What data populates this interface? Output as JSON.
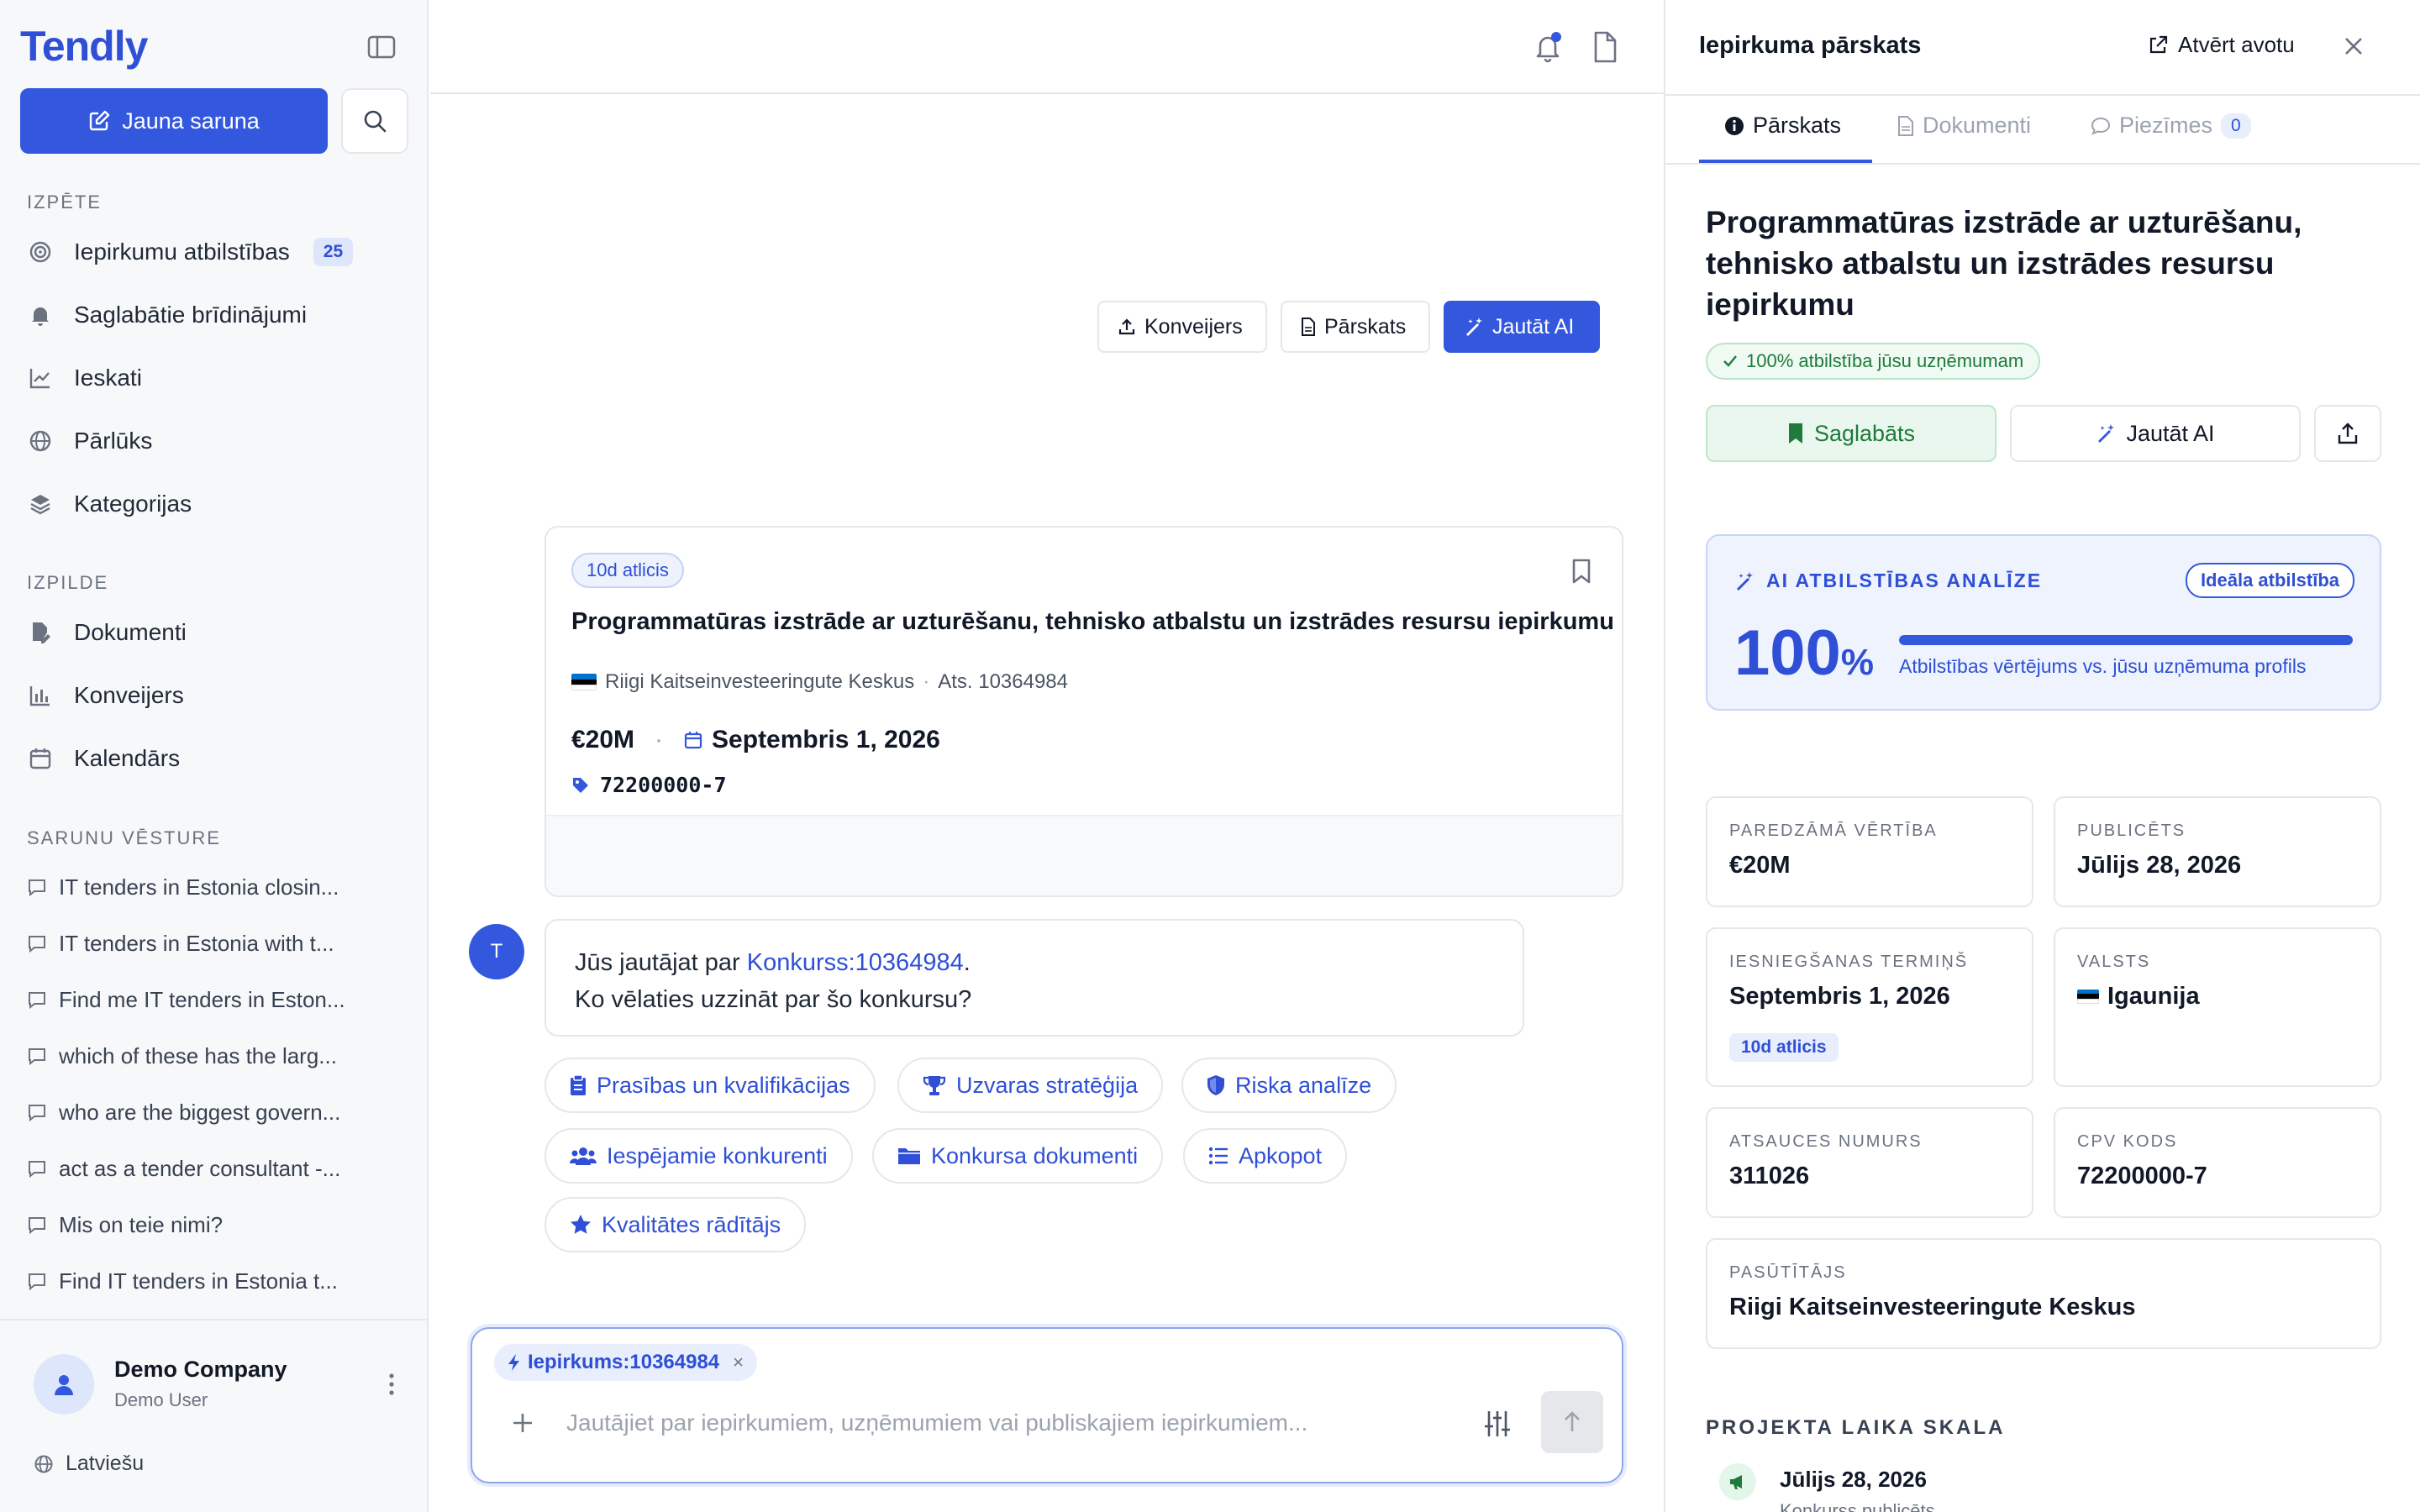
{
  "app": {
    "logo": "Tendly",
    "new_chat_label": "Jauna saruna"
  },
  "sidebar": {
    "research_label": "IZPĒTE",
    "research_items": [
      {
        "label": "Iepirkumu atbilstības",
        "badge": "25",
        "icon": "target-icon"
      },
      {
        "label": "Saglabātie brīdinājumi",
        "icon": "bell-icon"
      },
      {
        "label": "Ieskati",
        "icon": "chart-line-icon"
      },
      {
        "label": "Pārlūks",
        "icon": "globe-icon"
      },
      {
        "label": "Kategorijas",
        "icon": "layers-icon"
      }
    ],
    "execution_label": "IZPILDE",
    "execution_items": [
      {
        "label": "Dokumenti",
        "icon": "file-edit-icon"
      },
      {
        "label": "Konveijers",
        "icon": "bar-chart-icon"
      },
      {
        "label": "Kalendārs",
        "icon": "calendar-icon"
      }
    ],
    "history_label": "SARUNU VĒSTURE",
    "history": [
      "IT tenders in Estonia closin...",
      "IT tenders in Estonia with t...",
      "Find me IT tenders in Eston...",
      "which of these has the larg...",
      "who are the biggest govern...",
      "act as a tender consultant -...",
      "Mis on teie nimi?",
      "Find IT tenders in Estonia t..."
    ],
    "user": {
      "name": "Demo Company",
      "sub": "Demo User",
      "initial_icon": "user-icon"
    },
    "language": "Latviešu"
  },
  "tender_card": {
    "days_left": "10d atlicis",
    "title": "Programmatūras izstrāde ar uzturēšanu, tehnisko atbalstu un izstrādes resursu iepirkumu",
    "buyer": "Riigi Kaitseinvesteeringute Keskus",
    "separator": "·",
    "ref": "Ats. 10364984",
    "value": "€20M",
    "deadline": "Septembris 1, 2026",
    "cpv": "72200000-7",
    "actions": {
      "pipeline": "Konveijers",
      "overview": "Pārskats",
      "ask_ai": "Jautāt AI"
    }
  },
  "message": {
    "avatar": "T",
    "text_before": "Jūs jautājat par ",
    "link": "Konkurss:10364984",
    "text_after": ".",
    "line2": "Ko vēlaties uzzināt par šo konkursu?"
  },
  "suggestions": [
    {
      "label": "Prasības un kvalifikācijas",
      "icon": "clipboard-icon"
    },
    {
      "label": "Uzvaras stratēģija",
      "icon": "trophy-icon"
    },
    {
      "label": "Riska analīze",
      "icon": "shield-icon"
    },
    {
      "label": "Iespējamie konkurenti",
      "icon": "users-icon"
    },
    {
      "label": "Konkursa dokumenti",
      "icon": "folder-icon"
    },
    {
      "label": "Apkopot",
      "icon": "list-icon"
    },
    {
      "label": "Kvalitātes rādītājs",
      "icon": "star-icon"
    }
  ],
  "composer": {
    "context_chip": "Iepirkums:10364984",
    "chip_remove": "×",
    "placeholder": "Jautājiet par iepirkumiem, uzņēmumiem vai publiskajiem iepirkumiem..."
  },
  "panel": {
    "title": "Iepirkuma pārskats",
    "open_source": "Atvērt avotu",
    "tabs": [
      {
        "label": "Pārskats",
        "active": true
      },
      {
        "label": "Dokumenti"
      },
      {
        "label": "Piezīmes",
        "count": "0"
      }
    ],
    "heading": "Programmatūras izstrāde ar uzturēšanu, tehnisko atbalstu un izstrādes resursu iepirkumu",
    "match_pill": "100% atbilstība jūsu uzņēmumam",
    "saved_label": "Saglabāts",
    "ask_label": "Jautāt AI",
    "ai": {
      "label": "AI ATBILSTĪBAS ANALĪZE",
      "pill": "Ideāla atbilstība",
      "score": "100",
      "pct": "%",
      "fill_fraction": 1.0,
      "desc": "Atbilstības vērtējums vs. jūsu uzņēmuma profils"
    },
    "info": {
      "value_label": "PAREDZĀMĀ VĒRTĪBA",
      "value": "€20M",
      "published_label": "PUBLICĒTS",
      "published": "Jūlijs 28, 2026",
      "deadline_label": "IESNIEGŠANAS TERMIŅŠ",
      "deadline": "Septembris 1, 2026",
      "deadline_pill": "10d atlicis",
      "country_label": "VALSTS",
      "country": "Igaunija",
      "ref_label": "ATSAUCES NUMURS",
      "ref": "311026",
      "cpv_label": "CPV KODS",
      "cpv": "72200000-7",
      "buyer_label": "PASŪTĪTĀJS",
      "buyer": "Riigi Kaitseinvesteeringute Keskus"
    },
    "timeline": {
      "label": "PROJEKTA LAIKA SKALA",
      "date": "Jūlijs 28, 2026",
      "sub": "Konkurss publicēts"
    }
  },
  "colors": {
    "accent": "#3358de",
    "success": "#1f7a3b",
    "flag_blue": "#0072ce",
    "flag_black": "#000000",
    "flag_white": "#ffffff"
  }
}
